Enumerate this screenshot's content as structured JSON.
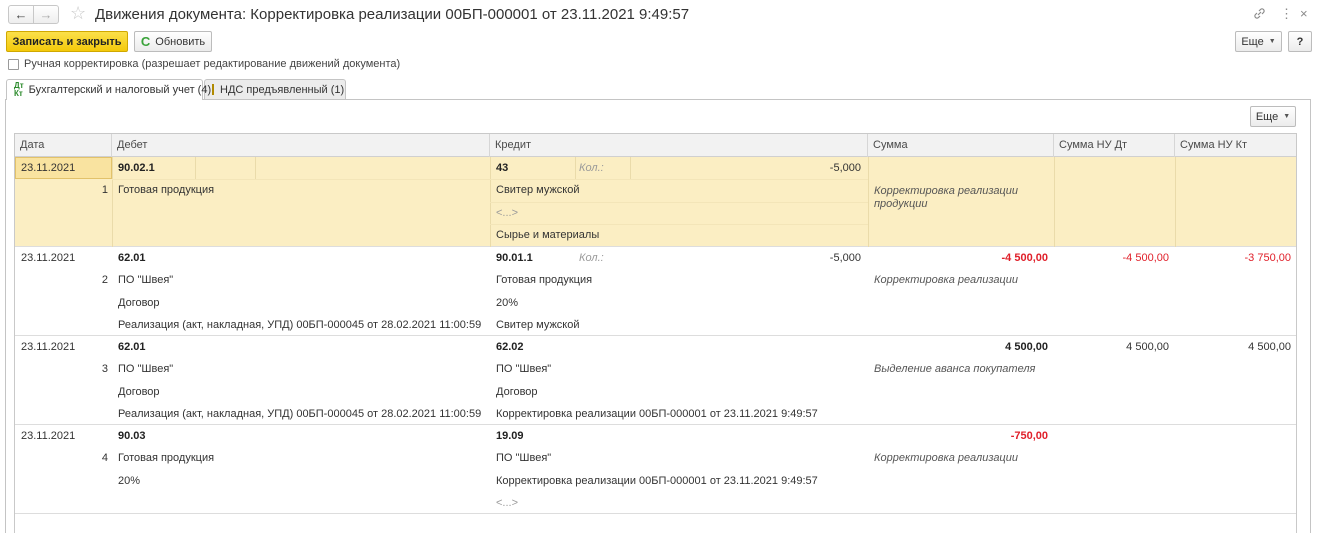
{
  "header": {
    "back_icon": "←",
    "forward_icon": "→",
    "star_icon": "☆",
    "title": "Движения документа: Корректировка реализации 00БП-000001 от 23.11.2021 9:49:57",
    "link_icon": "🔗",
    "more_icon": "⋮",
    "close_icon": "×"
  },
  "toolbar": {
    "save_close_label": "Записать и закрыть",
    "refresh_icon": "C",
    "refresh_label": "Обновить",
    "more_label": "Еще",
    "help_label": "?"
  },
  "manual_checkbox": {
    "checked": false,
    "label": "Ручная корректировка (разрешает редактирование движений документа)"
  },
  "tabs": [
    {
      "label": "Бухгалтерский и налоговый учет (4)",
      "icon": "Дт Кт",
      "active": true
    },
    {
      "label": "НДС предъявленный (1)",
      "icon": "document",
      "active": false
    }
  ],
  "table_more_label": "Еще",
  "colors": {
    "accent": "#f4c90a",
    "selected_row": "#fbeec3",
    "negative": "#e0202a"
  },
  "table": {
    "columns": [
      "Дата",
      "Дебет",
      "Кредит",
      "Сумма",
      "Сумма НУ Дт",
      "Сумма НУ Кт"
    ],
    "rows": [
      {
        "date": "23.11.2021",
        "num": "1",
        "debit_account": "90.02.1",
        "debit_lines": [
          "Готовая продукция"
        ],
        "credit_account": "43",
        "credit_qty_label": "Кол.:",
        "credit_qty": "-5,000",
        "credit_lines": [
          "Свитер мужской",
          "<...>",
          "Сырье и материалы"
        ],
        "sum": "",
        "sum_desc": "Корректировка реализации продукции",
        "nu_dt": "",
        "nu_kt": ""
      },
      {
        "date": "23.11.2021",
        "num": "2",
        "debit_account": "62.01",
        "debit_lines": [
          "ПО \"Швея\"",
          "Договор",
          "Реализация (акт, накладная, УПД) 00БП-000045 от 28.02.2021 11:00:59"
        ],
        "credit_account": "90.01.1",
        "credit_qty_label": "Кол.:",
        "credit_qty": "-5,000",
        "credit_lines": [
          "Готовая продукция",
          "20%",
          "Свитер мужской"
        ],
        "sum": "-4 500,00",
        "sum_desc": "Корректировка реализации",
        "nu_dt": "-4 500,00",
        "nu_kt": "-3 750,00"
      },
      {
        "date": "23.11.2021",
        "num": "3",
        "debit_account": "62.01",
        "debit_lines": [
          "ПО \"Швея\"",
          "Договор",
          "Реализация (акт, накладная, УПД) 00БП-000045 от 28.02.2021 11:00:59"
        ],
        "credit_account": "62.02",
        "credit_lines": [
          "ПО \"Швея\"",
          "Договор",
          "Корректировка реализации 00БП-000001 от 23.11.2021 9:49:57"
        ],
        "sum": "4 500,00",
        "sum_desc": "Выделение аванса покупателя",
        "nu_dt": "4 500,00",
        "nu_kt": "4 500,00"
      },
      {
        "date": "23.11.2021",
        "num": "4",
        "debit_account": "90.03",
        "debit_lines": [
          "Готовая продукция",
          "20%"
        ],
        "credit_account": "19.09",
        "credit_lines": [
          "ПО \"Швея\"",
          "Корректировка реализации 00БП-000001 от 23.11.2021 9:49:57",
          "<...>"
        ],
        "sum": "-750,00",
        "sum_desc": "Корректировка реализации",
        "nu_dt": "",
        "nu_kt": ""
      }
    ]
  }
}
